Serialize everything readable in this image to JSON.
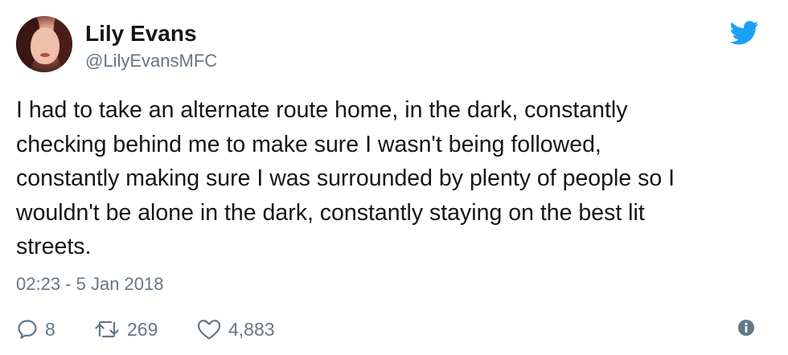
{
  "tweet": {
    "author_name": "Lily Evans",
    "author_handle": "@LilyEvansMFC",
    "text": "I had to take an alternate route home, in the dark, constantly\nchecking behind me to make sure I wasn't being followed,\nconstantly making sure I was surrounded by plenty of people so I\nwouldn't be alone in the dark, constantly staying on the best lit\nstreets.",
    "timestamp": "02:23 - 5 Jan 2018",
    "replies": "8",
    "retweets": "269",
    "likes": "4,883"
  },
  "icons": {
    "brand": "twitter-bird-icon",
    "reply": "reply-icon",
    "retweet": "retweet-icon",
    "like": "heart-icon",
    "info": "info-icon"
  },
  "colors": {
    "brand_blue": "#1da1f2",
    "secondary_text": "#657786",
    "primary_text": "#14171a"
  }
}
